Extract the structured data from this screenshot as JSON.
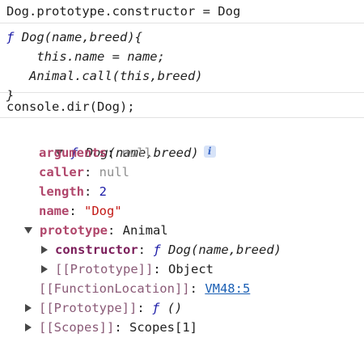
{
  "console": {
    "entries": {
      "assignment": {
        "text": "Dog.prototype.constructor = Dog"
      },
      "function_result": {
        "f_keyword": "ƒ",
        "line1_sig": "Dog(name,breed){",
        "line2": "    this.name = name;",
        "line3": "   Animal.call(this,breed)",
        "line4": "}"
      },
      "dir_command": {
        "text": "console.dir(Dog);"
      },
      "dir_output": {
        "root": {
          "f_keyword": "ƒ",
          "signature": "Dog(name,breed)",
          "info_badge": "i"
        },
        "properties": {
          "arguments": {
            "key": "arguments",
            "sep": ": ",
            "value": "null"
          },
          "caller": {
            "key": "caller",
            "sep": ": ",
            "value": "null"
          },
          "length": {
            "key": "length",
            "sep": ": ",
            "value": "2"
          },
          "name": {
            "key": "name",
            "sep": ": ",
            "value": "\"Dog\""
          },
          "prototype": {
            "key": "prototype",
            "sep": ": ",
            "value": "Animal"
          }
        },
        "prototype_children": {
          "constructor": {
            "key": "constructor",
            "sep": ": ",
            "f_keyword": "ƒ",
            "signature": "Dog(name,breed)"
          },
          "inner_prototype": {
            "key": "[[Prototype]]",
            "sep": ": ",
            "value": "Object"
          }
        },
        "function_location": {
          "key": "[[FunctionLocation]]",
          "sep": ": ",
          "link": "VM48:5"
        },
        "outer_prototype": {
          "key": "[[Prototype]]",
          "sep": ": ",
          "f_keyword": "ƒ",
          "value": "()"
        },
        "scopes": {
          "key": "[[Scopes]]",
          "sep": ": ",
          "value": "Scopes[1]"
        }
      }
    }
  }
}
